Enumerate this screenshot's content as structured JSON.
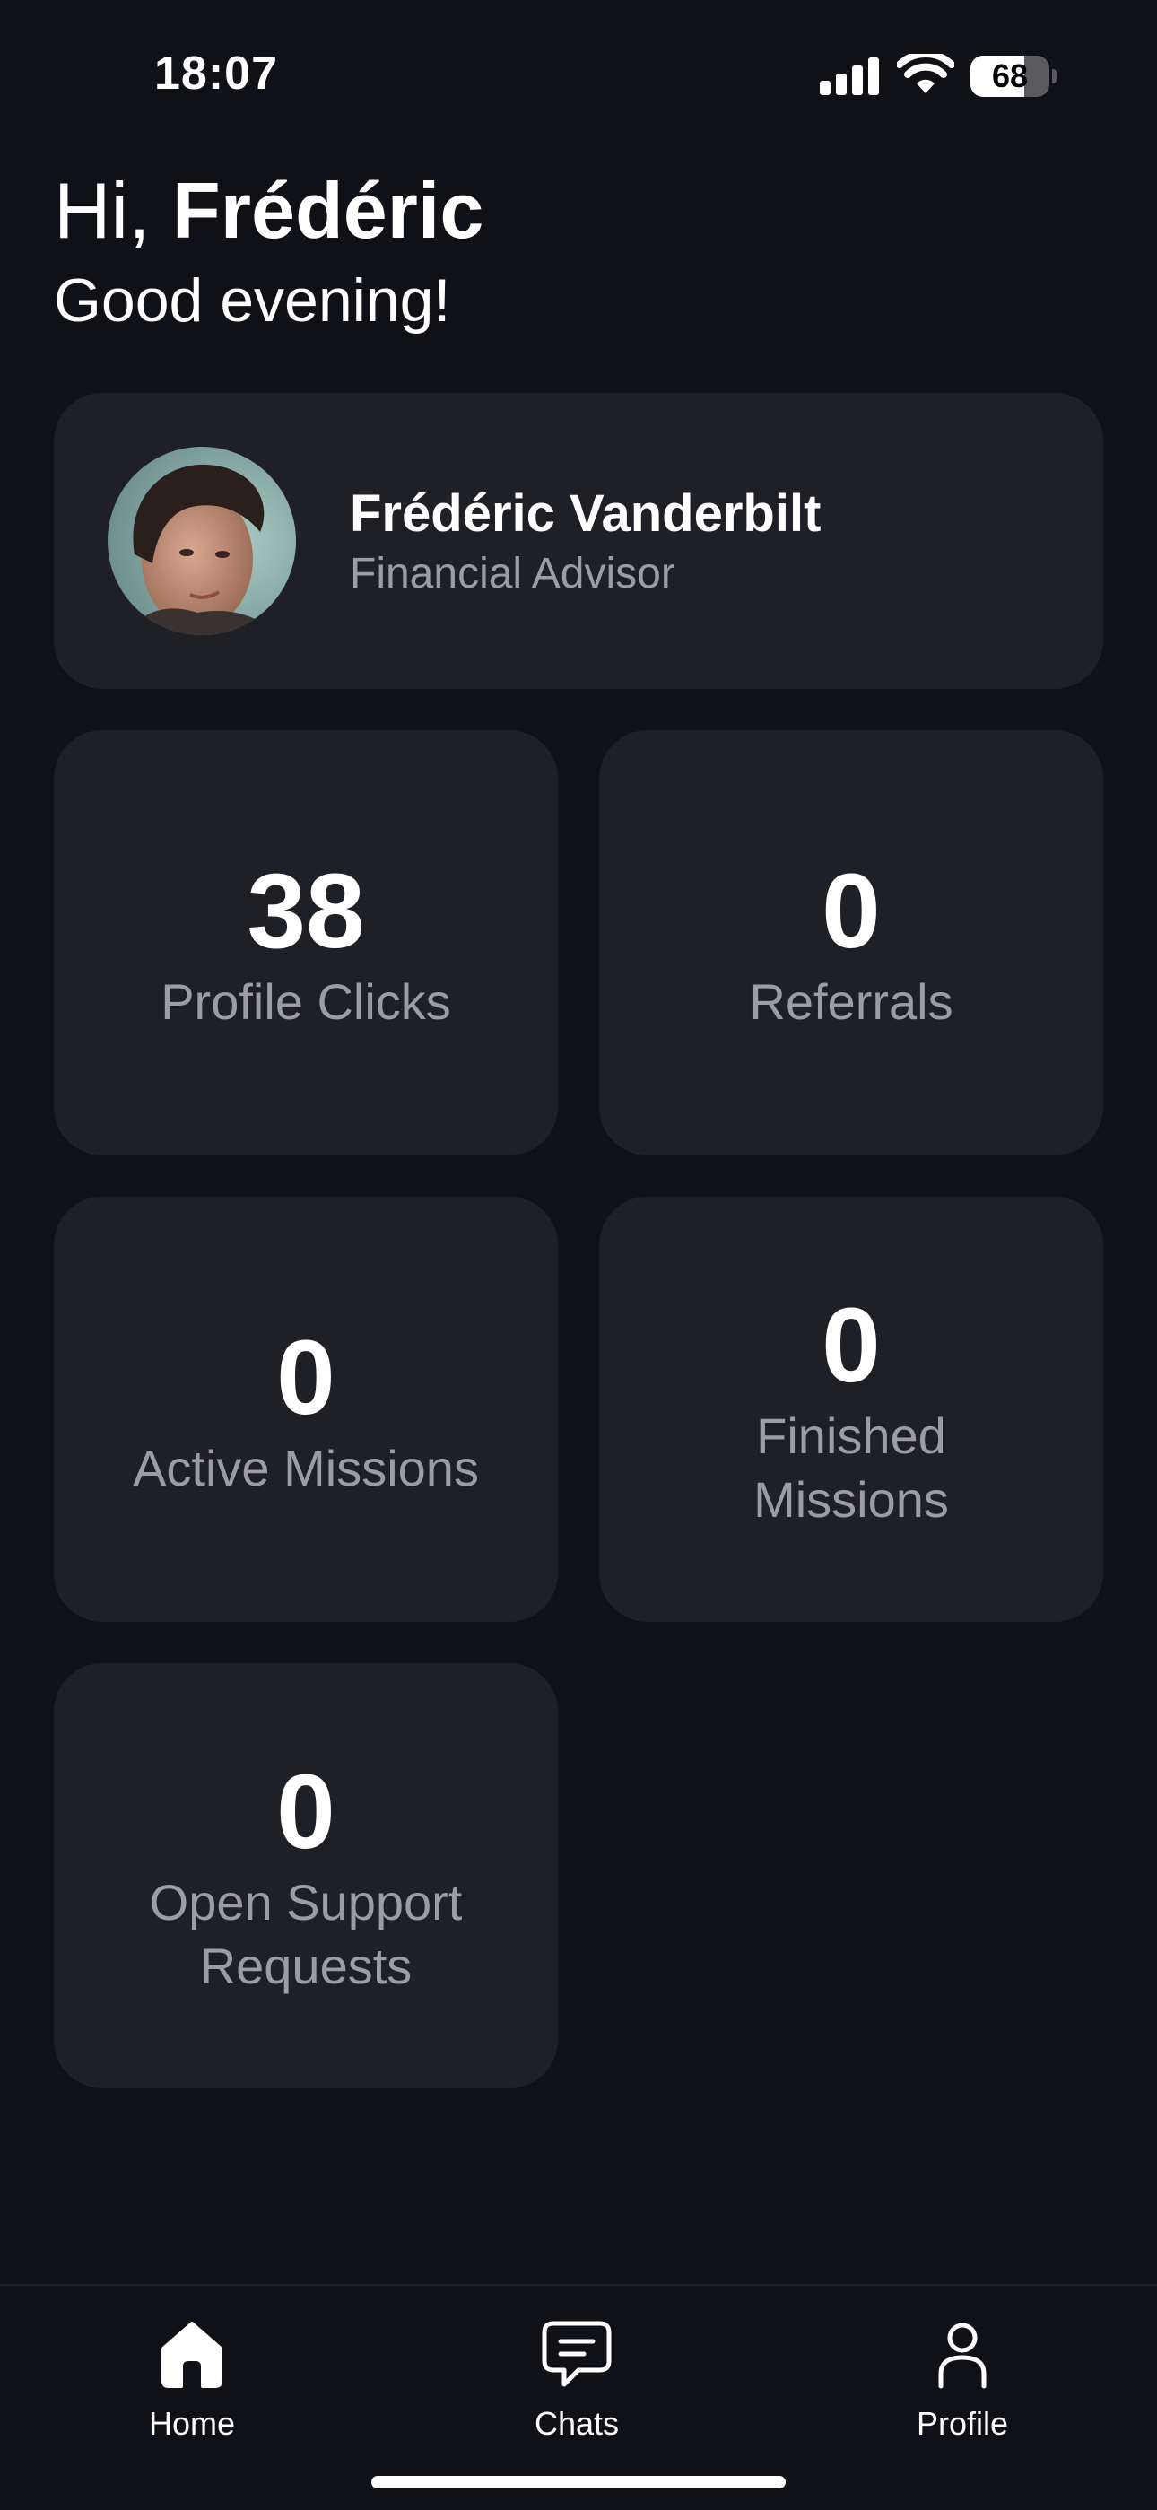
{
  "status_bar": {
    "time": "18:07",
    "battery_percent": 68,
    "battery_label": "68"
  },
  "greeting": {
    "hi": "Hi, ",
    "name": "Frédéric",
    "subtitle": "Good evening!"
  },
  "profile_card": {
    "name": "Frédéric Vanderbilt",
    "role": "Financial Advisor"
  },
  "stats": [
    {
      "value": "38",
      "label": "Profile Clicks"
    },
    {
      "value": "0",
      "label": "Referrals"
    },
    {
      "value": "0",
      "label": "Active Missions"
    },
    {
      "value": "0",
      "label": "Finished Missions"
    },
    {
      "value": "0",
      "label": "Open Support Requests"
    }
  ],
  "tab_bar": {
    "items": [
      {
        "label": "Home",
        "icon": "home-icon",
        "active": true
      },
      {
        "label": "Chats",
        "icon": "chat-icon",
        "active": false
      },
      {
        "label": "Profile",
        "icon": "person-icon",
        "active": false
      }
    ]
  },
  "colors": {
    "background": "#101116",
    "card": "#1f2025",
    "secondary_text": "#9c9ca4",
    "primary_text": "#ffffff"
  }
}
